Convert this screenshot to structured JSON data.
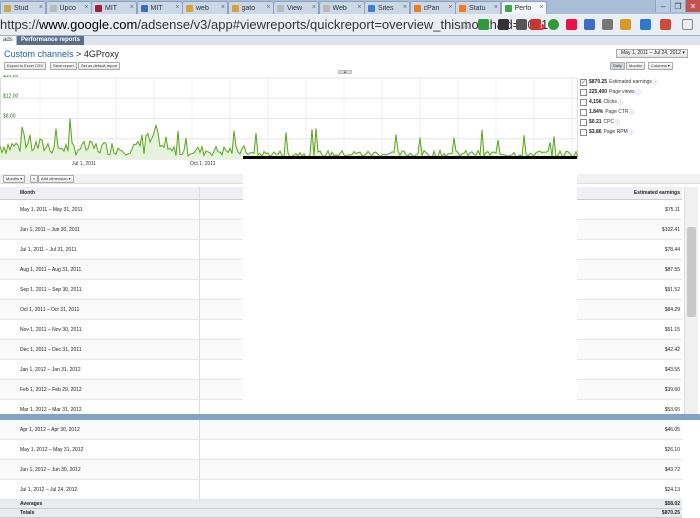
{
  "browser": {
    "tabs": [
      {
        "label": "Stud",
        "color": "#c9a94a"
      },
      {
        "label": "Upco",
        "color": "#b9b9b9"
      },
      {
        "label": "MIT",
        "color": "#a31f34"
      },
      {
        "label": "MIT",
        "color": "#3c6fb4"
      },
      {
        "label": "web",
        "color": "#d9a238"
      },
      {
        "label": "gato",
        "color": "#d9a238"
      },
      {
        "label": "View",
        "color": "#b9b9b9"
      },
      {
        "label": "Web",
        "color": "#b9b9b9"
      },
      {
        "label": "Sites",
        "color": "#3b82d6"
      },
      {
        "label": "cPan",
        "color": "#f07c1f"
      },
      {
        "label": "Statu",
        "color": "#f07c1f"
      },
      {
        "label": "Perfo",
        "color": "#3aa845"
      }
    ],
    "window_buttons": [
      "–",
      "❐",
      "✕"
    ],
    "url_prefix": "https://",
    "url_host": "www.google.com",
    "url_rest": "/adsense/v3/app#viewreports/quickreport=overview_thismonth&d=2011",
    "ext_badge": "1"
  },
  "app": {
    "subnav_left": "ads",
    "subnav_tab": "Performance reports",
    "crumb_link": "Custom channels",
    "crumb_sep": " > ",
    "crumb_current": "4GProxy",
    "date_range": "May 1, 2011 – Jul 24, 2012",
    "buttons": {
      "export": "Export to Excel CSV",
      "save": "Save report",
      "default": "Set as default report",
      "daily": "Daily",
      "monthly": "Months",
      "columns": "Columns"
    },
    "collapse": "▲"
  },
  "chart_data": {
    "type": "line",
    "series": [
      {
        "name": "Estimated earnings",
        "color": "#5aa51a"
      }
    ],
    "y_ticks": [
      "$16.00",
      "$12.00",
      "$8.00"
    ],
    "x_ticks": [
      "Jul 1, 2011",
      "Oct 1, 2011"
    ],
    "ylim": [
      0,
      16
    ]
  },
  "metrics": [
    {
      "value": "$870.25",
      "label": "Estimated earnings",
      "checked": true
    },
    {
      "value": "225,400",
      "label": "Page views",
      "checked": false
    },
    {
      "value": "4,156",
      "label": "Clicks",
      "checked": false
    },
    {
      "value": "1.84%",
      "label": "Page CTR",
      "checked": false
    },
    {
      "value": "$0.21",
      "label": "CPC",
      "checked": false
    },
    {
      "value": "$3.86",
      "label": "Page RPM",
      "checked": false
    }
  ],
  "dimension_bar": {
    "dim": "Months",
    "add": "Add dimension"
  },
  "table": {
    "col_month": "Month",
    "col_earnings": "Estimated earnings",
    "rows": [
      {
        "month": "May 1, 2011 – May 31, 2011",
        "earnings": "$75.11"
      },
      {
        "month": "Jun 1, 2011 – Jun 30, 2011",
        "earnings": "$102.41"
      },
      {
        "month": "Jul 1, 2011 – Jul 31, 2011",
        "earnings": "$78.44"
      },
      {
        "month": "Aug 1, 2011 – Aug 31, 2011",
        "earnings": "$87.55"
      },
      {
        "month": "Sep 1, 2011 – Sep 30, 2011",
        "earnings": "$91.52"
      },
      {
        "month": "Oct 1, 2011 – Oct 31, 2011",
        "earnings": "$84.29"
      },
      {
        "month": "Nov 1, 2011 – Nov 30, 2011",
        "earnings": "$51.15"
      },
      {
        "month": "Dec 1, 2011 – Dec 31, 2011",
        "earnings": "$42.42"
      },
      {
        "month": "Jan 1, 2012 – Jan 31, 2012",
        "earnings": "$43.55"
      },
      {
        "month": "Feb 1, 2012 – Feb 29, 2012",
        "earnings": "$39.60"
      },
      {
        "month": "Mar 1, 2012 – Mar 31, 2012",
        "earnings": "$53.65"
      },
      {
        "month": "Apr 1, 2012 – Apr 30, 2012",
        "earnings": "$46.05"
      },
      {
        "month": "May 1, 2012 – May 31, 2012",
        "earnings": "$26.10"
      },
      {
        "month": "Jun 1, 2012 – Jun 30, 2012",
        "earnings": "$43.72"
      },
      {
        "month": "Jul 1, 2012 – Jul 24, 2012",
        "earnings": "$24.13"
      }
    ],
    "averages_label": "Averages",
    "averages_value": "$58.02",
    "totals_label": "Totals",
    "totals_value": "$870.25"
  }
}
